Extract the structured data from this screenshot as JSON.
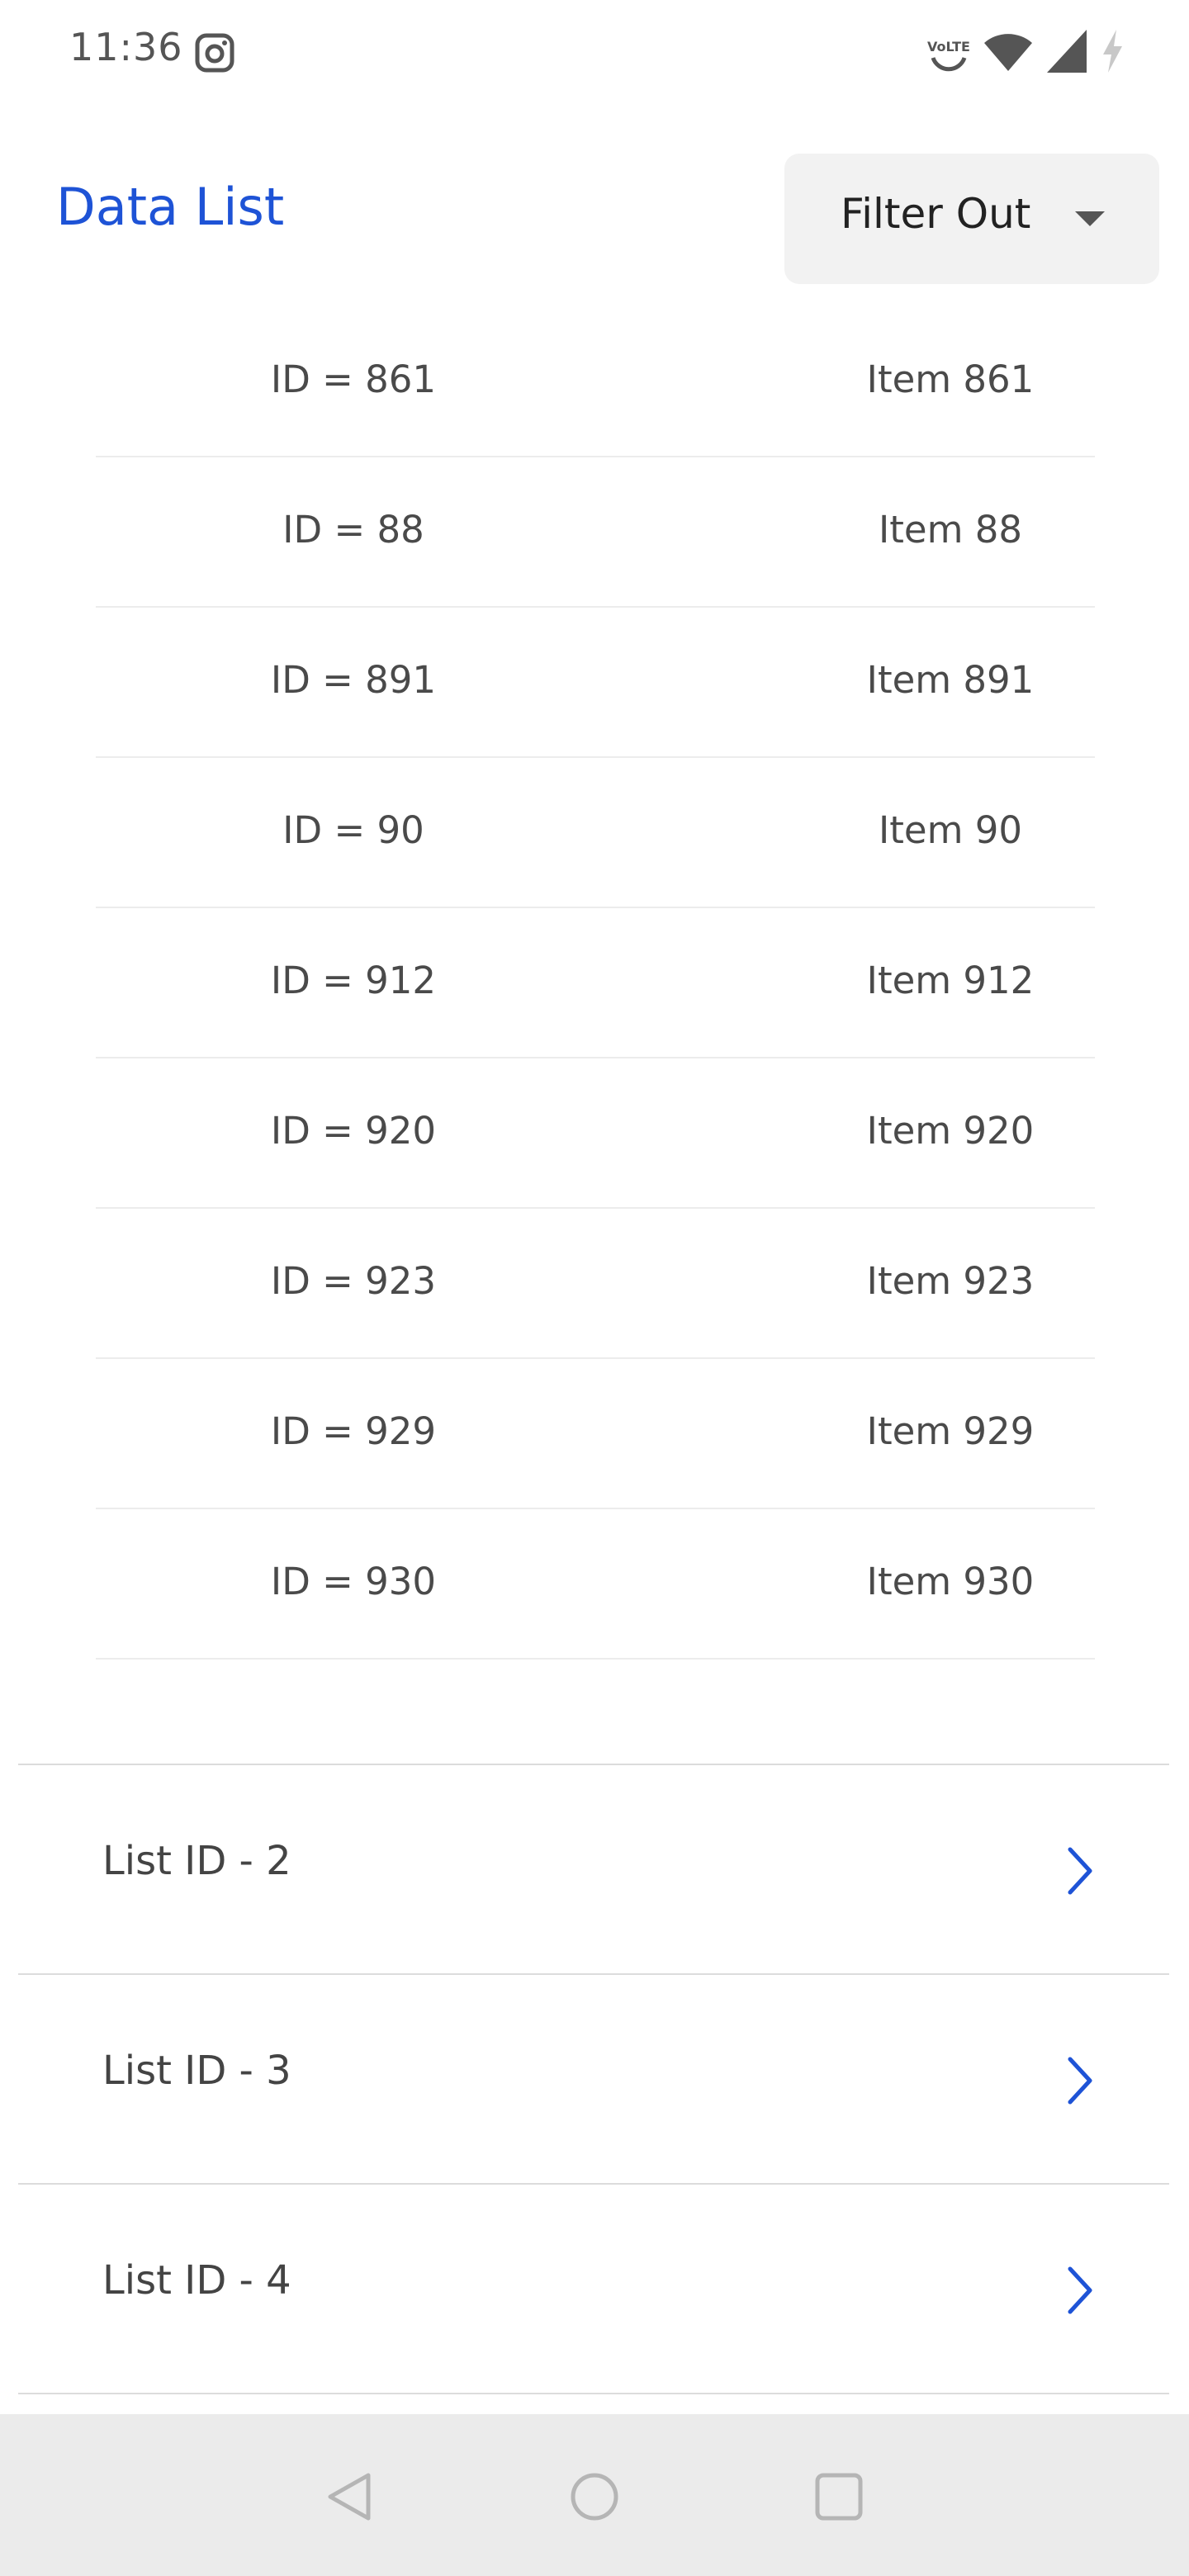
{
  "status_bar": {
    "time": "11:36",
    "left_icon": "instagram-icon",
    "right_icons": [
      "volte-icon",
      "wifi-icon",
      "signal-icon",
      "battery-charging-icon"
    ],
    "volte_text": "VoLTE"
  },
  "header": {
    "title": "Data List",
    "filter_label": "Filter Out"
  },
  "items": [
    {
      "id_text": "ID = 861",
      "name": "Item 861"
    },
    {
      "id_text": "ID = 88",
      "name": "Item 88"
    },
    {
      "id_text": "ID = 891",
      "name": "Item 891"
    },
    {
      "id_text": "ID = 90",
      "name": "Item 90"
    },
    {
      "id_text": "ID = 912",
      "name": "Item 912"
    },
    {
      "id_text": "ID = 920",
      "name": "Item 920"
    },
    {
      "id_text": "ID = 923",
      "name": "Item 923"
    },
    {
      "id_text": "ID = 929",
      "name": "Item 929"
    },
    {
      "id_text": "ID = 930",
      "name": "Item 930"
    }
  ],
  "list_groups": [
    {
      "label": "List ID - 2"
    },
    {
      "label": "List ID - 3"
    },
    {
      "label": "List ID - 4"
    }
  ],
  "nav_bar": {
    "buttons": [
      "back-icon",
      "home-icon",
      "recents-icon"
    ]
  },
  "colors": {
    "accent": "#1e53d6",
    "text": "#4a4a4a",
    "divider": "#dcdcdc",
    "nav_background": "#ebebeb",
    "filter_background": "#f2f2f2"
  }
}
